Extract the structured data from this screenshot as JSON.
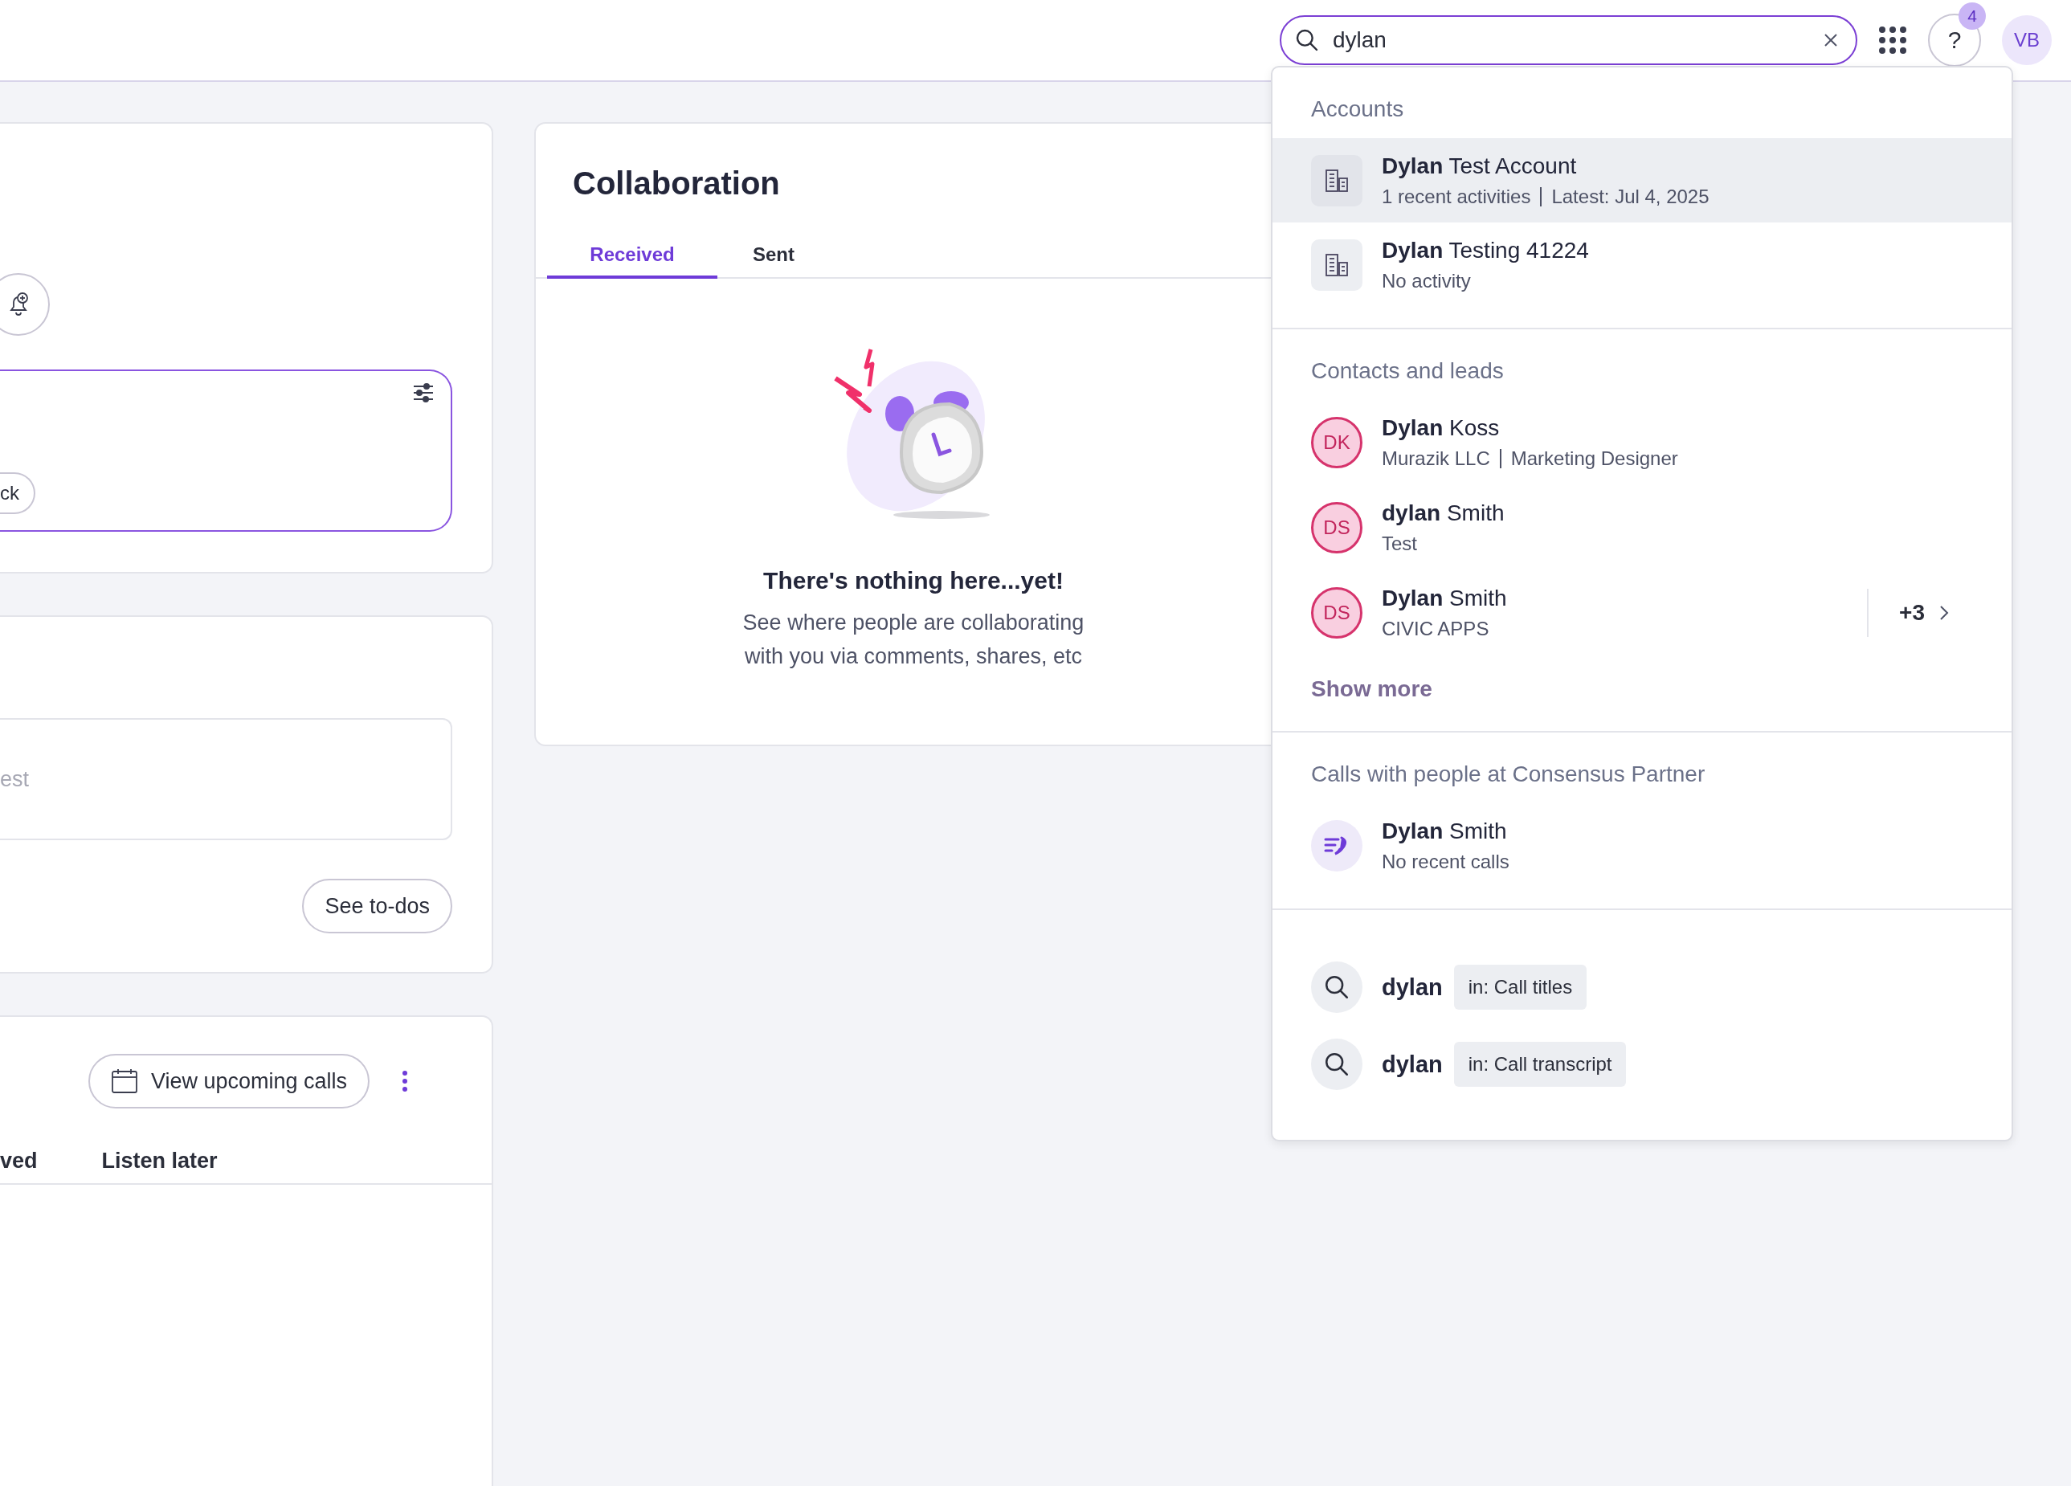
{
  "topbar": {
    "search": {
      "value": "dylan"
    },
    "help_button": {
      "label": "?",
      "badge": "4"
    },
    "avatar": {
      "initials": "VB"
    }
  },
  "left_cards": {
    "alerts": {
      "pill": "ck"
    },
    "todos": {
      "field_placeholder": "est",
      "button": "See to-dos"
    },
    "calls": {
      "button": "View upcoming calls",
      "tabs": [
        "ved",
        "Listen later"
      ]
    }
  },
  "collaboration": {
    "title": "Collaboration",
    "tabs": [
      {
        "label": "Received",
        "selected": true
      },
      {
        "label": "Sent",
        "selected": false
      }
    ],
    "empty_title": "There's nothing here...yet!",
    "empty_text": "See where people are collaborating with you via comments, shares, etc"
  },
  "search_results": {
    "sections": [
      {
        "kind": "accounts",
        "title": "Accounts",
        "items": [
          {
            "name": "**Dylan** Test Account",
            "details": [
              "1 recent activities",
              "Latest: Jul 4, 2025"
            ],
            "selected": true
          },
          {
            "name": "**Dylan** Testing 41224",
            "details": [
              "No activity"
            ],
            "selected": false
          }
        ]
      },
      {
        "kind": "contacts",
        "title": "Contacts and leads",
        "items": [
          {
            "initials": "DK",
            "name": "**Dylan** Koss",
            "details": [
              "Murazik LLC",
              "Marketing Designer"
            ]
          },
          {
            "initials": "DS",
            "name": "**dylan** Smith",
            "details": [
              "Test"
            ]
          },
          {
            "initials": "DS",
            "name": "**Dylan** Smith",
            "details": [
              "CIVIC APPS"
            ],
            "extra": "+3"
          }
        ],
        "show_more": "Show more"
      },
      {
        "kind": "calls",
        "title": "Calls with people at Consensus Partner",
        "items": [
          {
            "name": "**Dylan** Smith",
            "details": [
              "No recent calls"
            ]
          }
        ]
      },
      {
        "kind": "queries",
        "items": [
          {
            "query": "dylan",
            "scope": "in: Call titles"
          },
          {
            "query": "dylan",
            "scope": "in: Call transcript"
          }
        ]
      }
    ]
  }
}
